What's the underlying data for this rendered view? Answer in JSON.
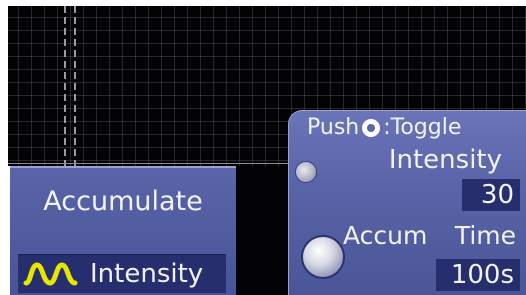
{
  "colors": {
    "panel": "#5a64a8",
    "value_box": "#262e6e",
    "text": "#f2f2f6",
    "waveform_icon": "#e6e600",
    "screen_background": "#030306"
  },
  "accumulate_panel": {
    "title": "Accumulate",
    "mode": {
      "icon": "waveform-icon",
      "label": "Intensity"
    }
  },
  "knob_panel": {
    "push_prefix": "Push",
    "push_icon": "knob-push-icon",
    "push_suffix": ":Toggle",
    "intensity": {
      "label": "Intensity",
      "value": "30",
      "knob_icon": "small-knob-icon"
    },
    "accum_time": {
      "label_left": "Accum",
      "label_right": "Time",
      "value": "100s",
      "knob_icon": "large-knob-icon"
    }
  }
}
